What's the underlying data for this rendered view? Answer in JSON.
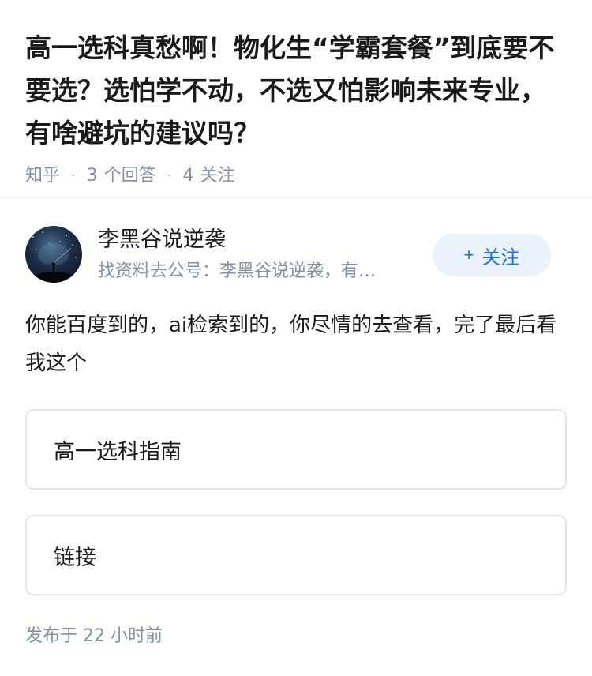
{
  "question": {
    "title": "高一选科真愁啊！物化生“学霸套餐”到底要不要选？选怕学不动，不选又怕影响未来专业，有啥避坑的建议吗？",
    "source": "知乎",
    "answers_count": "3",
    "answers_label": "个回答",
    "followers_count": "4",
    "followers_label": "关注"
  },
  "author": {
    "name": "李黑谷说逆袭",
    "bio": "找资料去公号：李黑谷说逆袭，有…",
    "follow_label": "关注",
    "follow_icon": "plus-icon",
    "avatar_icon": "starry-night-avatar"
  },
  "answer": {
    "text": "你能百度到的，ai检索到的，你尽情的去查看，完了最后看我这个",
    "cards": [
      {
        "label": "高一选科指南"
      },
      {
        "label": "链接"
      }
    ],
    "published": "发布于 22 小时前"
  },
  "colors": {
    "accent": "#1772f6",
    "follow_bg": "#ebf2fb",
    "meta_text": "#8590a6",
    "border": "#e6e6e6"
  }
}
